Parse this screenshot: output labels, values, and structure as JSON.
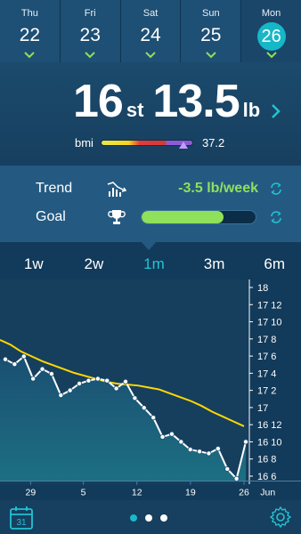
{
  "dates": [
    {
      "dow": "Thu",
      "day": "22"
    },
    {
      "dow": "Fri",
      "day": "23"
    },
    {
      "dow": "Sat",
      "day": "24"
    },
    {
      "dow": "Sun",
      "day": "25"
    },
    {
      "dow": "Mon",
      "day": "26"
    }
  ],
  "weight": {
    "stones": "16",
    "stones_unit": "st",
    "pounds": "13.5",
    "pounds_unit": "lb"
  },
  "bmi": {
    "label": "bmi",
    "value": "37.2",
    "value_num": 37.2,
    "scale_min": 15,
    "scale_max": 40
  },
  "trend": {
    "label": "Trend",
    "value": "-3.5 lb/week"
  },
  "goal": {
    "label": "Goal",
    "progress": 0.72
  },
  "range_tabs": [
    "1w",
    "2w",
    "1m",
    "3m",
    "6m"
  ],
  "active_range": "1m",
  "colors": {
    "accent": "#22c3d3",
    "trend_line": "#ffd700",
    "positive": "#8fe05a"
  },
  "chart_data": {
    "type": "line",
    "y_ticks": [
      "18",
      "17 12",
      "17 10",
      "17 8",
      "17 6",
      "17 4",
      "17 2",
      "17",
      "16 12",
      "16 10",
      "16 8",
      "16 6"
    ],
    "ylim_lb": [
      232,
      252
    ],
    "x_ticks": [
      "29",
      "5",
      "12",
      "19",
      "26",
      "Jun"
    ],
    "series": [
      {
        "name": "",
        "values": [
          246.5,
          246,
          245.3,
          244.8,
          244.3,
          243.9,
          243.5,
          243.1,
          242.8,
          242.5,
          242.2,
          242.0,
          241.9,
          241.8,
          241.6,
          241.4,
          241.0,
          240.6,
          240.2,
          239.7,
          239.1,
          238.6,
          238.1,
          237.6
        ]
      },
      {
        "name": "",
        "values": [
          244.5,
          244.0,
          244.8,
          242.5,
          243.5,
          243.0,
          240.8,
          241.3,
          242.0,
          242.3,
          242.5,
          242.3,
          241.5,
          242.2,
          240.5,
          239.5,
          238.5,
          236.5,
          236.8,
          236.0,
          235.2,
          235.0,
          234.8,
          235.3,
          233.2,
          232.2,
          236.0
        ]
      }
    ]
  }
}
